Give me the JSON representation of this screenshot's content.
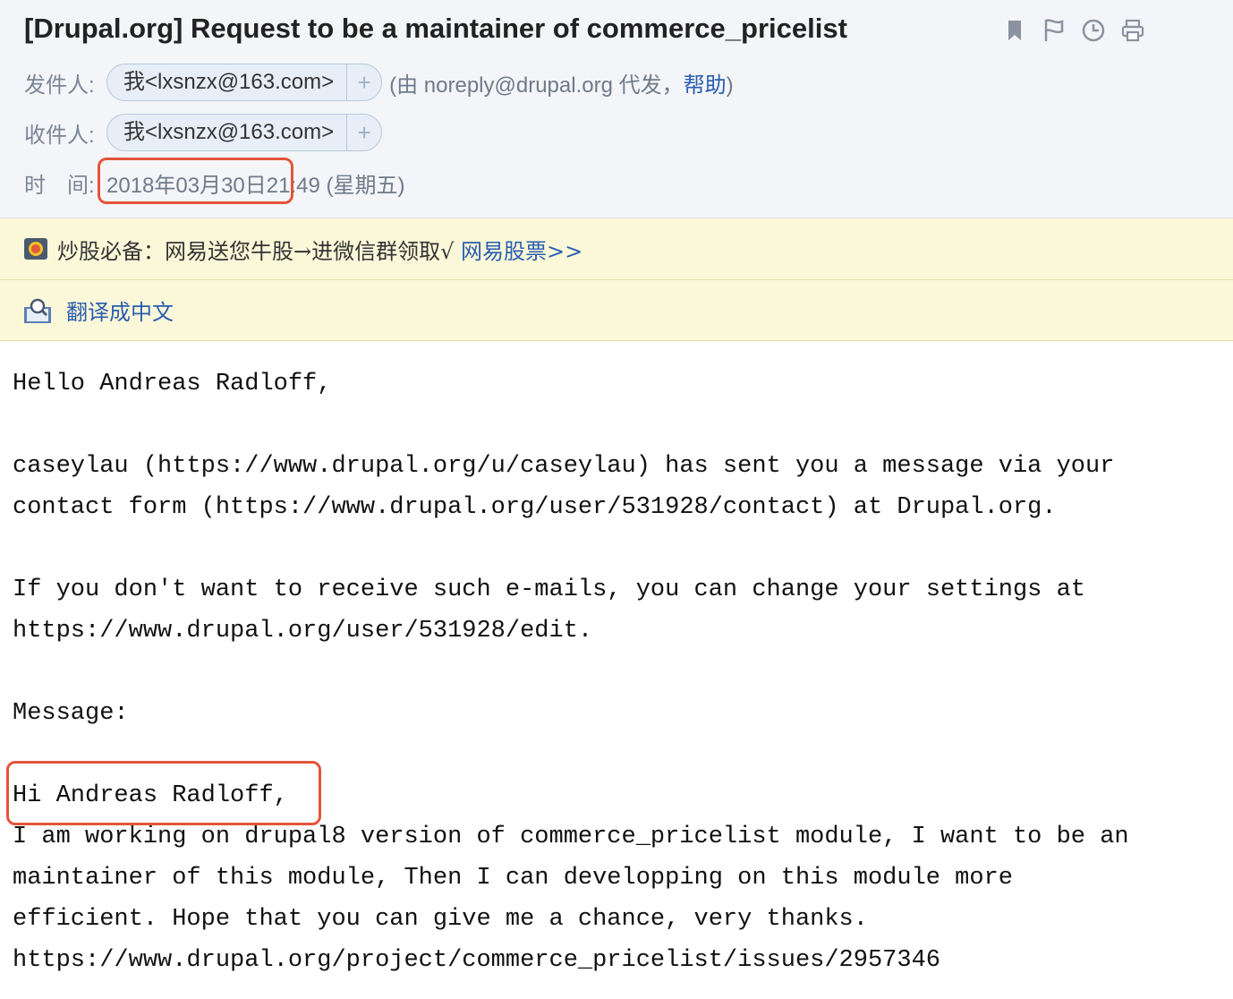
{
  "email": {
    "subject": "[Drupal.org] Request to be a maintainer of commerce_pricelist",
    "toolbar_icons": [
      "bookmark-icon",
      "flag-icon",
      "clock-icon",
      "print-icon"
    ],
    "from": {
      "label": "发件人:",
      "name": "我<lxsnzx@163.com>",
      "add": "+",
      "proxy_prefix": "(由 noreply@drupal.org 代发，",
      "help": "帮助",
      "proxy_suffix": ")"
    },
    "to": {
      "label": "收件人:",
      "name": "我<lxsnzx@163.com>",
      "add": "+"
    },
    "time": {
      "label": "时　间:",
      "date": "2018年03月30日",
      "rest": " 21:49 (星期五)"
    }
  },
  "ad_banner": {
    "text": "炒股必备：网易送您牛股→进微信群领取√ ",
    "link": "网易股票>>"
  },
  "translate_banner": {
    "text": "翻译成中文"
  },
  "body_lines": [
    "Hello Andreas Radloff,",
    "",
    "caseylau (https://www.drupal.org/u/caseylau) has sent you a message via your",
    "contact form (https://www.drupal.org/user/531928/contact) at Drupal.org.",
    "",
    "If you don't want to receive such e-mails, you can change your settings at",
    "https://www.drupal.org/user/531928/edit.",
    "",
    "Message:",
    "",
    "Hi Andreas Radloff,",
    "I am working on drupal8 version of commerce_pricelist module, I want to be an",
    "maintainer of this module, Then I can developping on this module more",
    "efficient. Hope that you can give me a chance, very thanks.",
    "https://www.drupal.org/project/commerce_pricelist/issues/2957346"
  ],
  "colors": {
    "highlight": "#e4543a",
    "link": "#2a5db0",
    "banner_bg": "#fbf8d9"
  }
}
